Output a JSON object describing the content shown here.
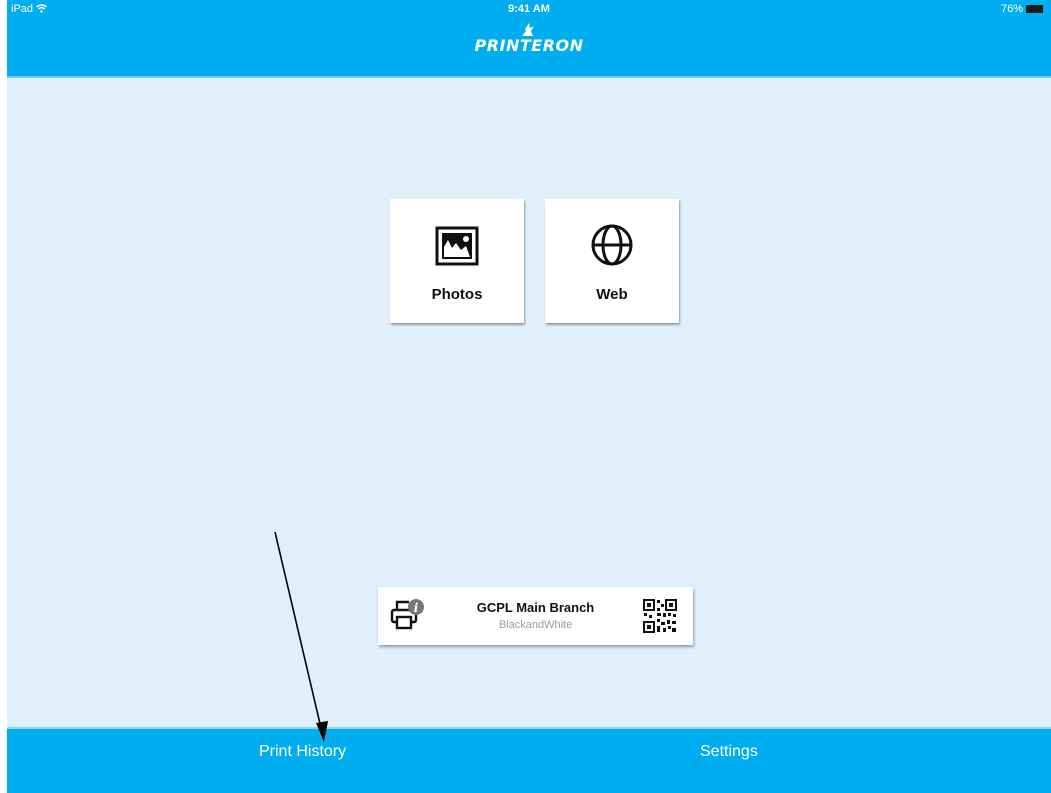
{
  "status_bar": {
    "device": "iPad",
    "wifi_icon": "wifi-icon",
    "time": "9:41 AM",
    "battery": "76%"
  },
  "header": {
    "logo_text": "PRINTERON",
    "logo_icon": "bird-icon"
  },
  "tiles": [
    {
      "label": "Photos",
      "icon": "photo-icon"
    },
    {
      "label": "Web",
      "icon": "globe-icon"
    }
  ],
  "printer": {
    "name": "GCPL Main Branch",
    "mode": "BlackandWhite",
    "printer_icon": "printer-info-icon",
    "qr_icon": "qr-code-icon"
  },
  "tabs": [
    {
      "label": "Print History"
    },
    {
      "label": "Settings"
    }
  ],
  "colors": {
    "brand": "#00aeef",
    "background": "#dff0fb"
  },
  "annotation": {
    "arrow_icon": "annotation-arrow"
  }
}
